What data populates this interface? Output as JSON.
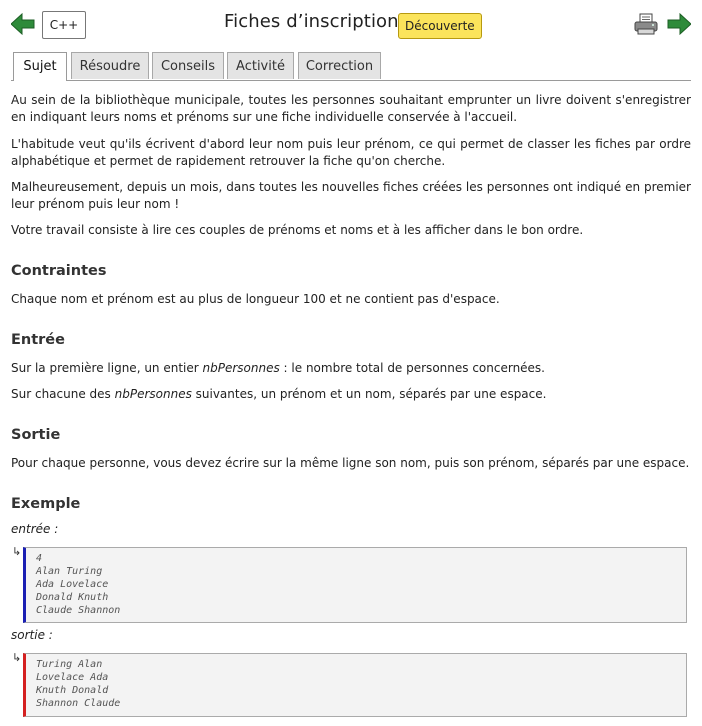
{
  "header": {
    "language": "C++",
    "title": "Fiches d’inscription",
    "level_badge": "Découverte"
  },
  "tabs": [
    "Sujet",
    "Résoudre",
    "Conseils",
    "Activité",
    "Correction"
  ],
  "statement": {
    "p1": "Au sein de la bibliothèque municipale, toutes les personnes souhaitant emprunter un livre doivent s'enregistrer en indiquant leurs noms et prénoms sur une fiche individuelle conservée à l'accueil.",
    "p2": "L'habitude veut qu'ils écrivent d'abord leur nom puis leur prénom, ce qui permet de classer les fiches par ordre alphabétique et permet de rapidement retrouver la fiche qu'on cherche.",
    "p3": "Malheureusement, depuis un mois, dans toutes les nouvelles fiches créées les personnes ont indiqué en premier leur prénom puis leur nom !",
    "p4": "Votre travail consiste à lire ces couples de prénoms et noms et à les afficher dans le bon ordre."
  },
  "constraints": {
    "heading": "Contraintes",
    "text": "Chaque nom et prénom est au plus de longueur 100 et ne contient pas d'espace."
  },
  "input": {
    "heading": "Entrée",
    "line1_before": "Sur la première ligne, un entier ",
    "line1_var": "nbPersonnes",
    "line1_after": " : le nombre total de personnes concernées.",
    "line2_before": "Sur chacune des ",
    "line2_var": "nbPersonnes",
    "line2_after": " suivantes, un prénom et un nom, séparés par une espace."
  },
  "output": {
    "heading": "Sortie",
    "text": "Pour chaque personne, vous devez écrire sur la même ligne son nom, puis son prénom, séparés par une espace."
  },
  "example": {
    "heading": "Exemple",
    "input_label": "entrée :",
    "input_lines": [
      "4",
      "Alan Turing",
      "Ada Lovelace",
      "Donald Knuth",
      "Claude Shannon"
    ],
    "output_label": "sortie :",
    "output_lines": [
      "Turing Alan",
      "Lovelace Ada",
      "Knuth Donald",
      "Shannon Claude"
    ],
    "arrow_glyph": "↳"
  },
  "colors": {
    "badge": "#fbe45b",
    "nav_arrow": "#2e8b3a",
    "input_border": "#1a1fb3",
    "output_border": "#d42020"
  },
  "icons": [
    "back-arrow-icon",
    "print-icon",
    "next-arrow-icon",
    "return-arrow-icon"
  ]
}
